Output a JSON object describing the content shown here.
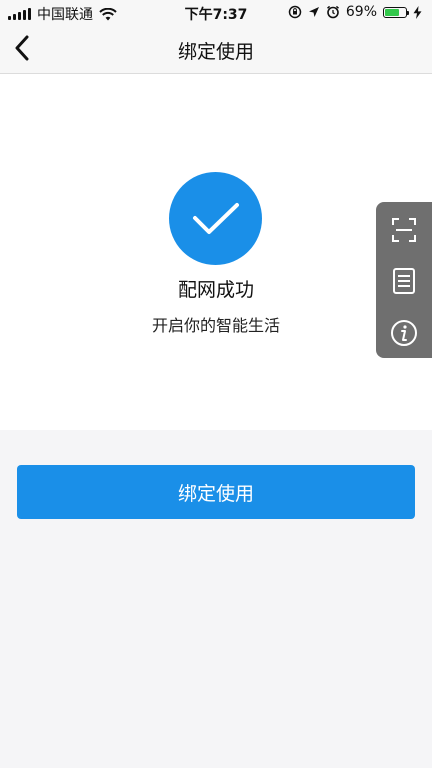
{
  "status_bar": {
    "carrier": "中国联通",
    "time": "下午7:37",
    "battery_percent": "69%",
    "battery_level": 0.69,
    "battery_color": "#32c84b"
  },
  "nav": {
    "title": "绑定使用",
    "back_icon": "chevron-left-icon"
  },
  "result": {
    "icon": "checkmark-icon",
    "title": "配网成功",
    "subtitle": "开启你的智能生活",
    "accent_color": "#1a8fe8"
  },
  "side_toolbar": {
    "items": [
      {
        "icon": "scan-icon"
      },
      {
        "icon": "document-icon"
      },
      {
        "icon": "info-icon"
      }
    ]
  },
  "primary_button": {
    "label": "绑定使用",
    "color": "#1a8fe8"
  }
}
